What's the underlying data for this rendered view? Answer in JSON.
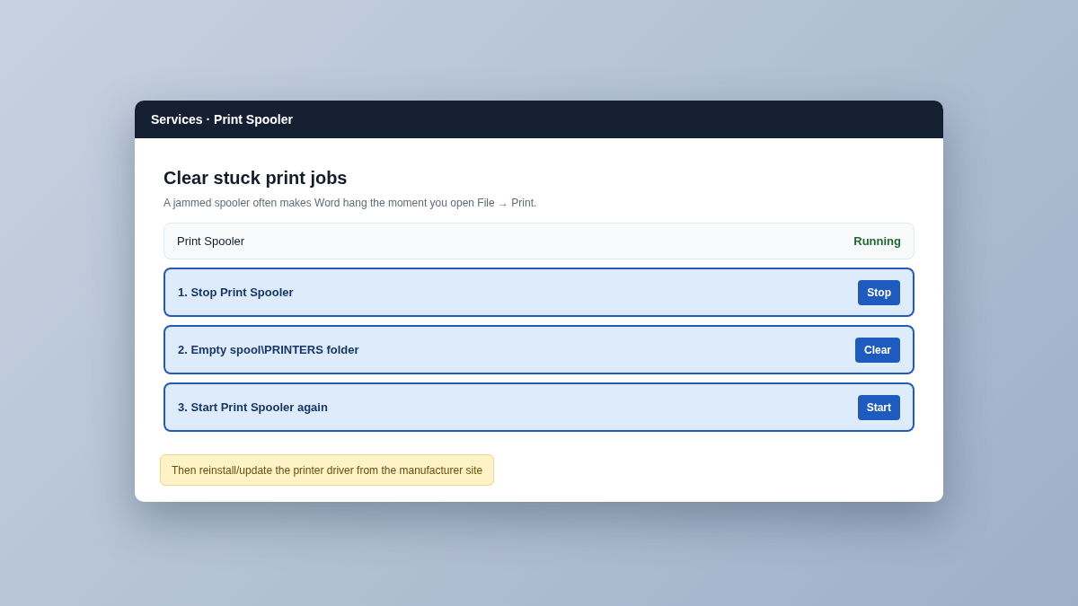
{
  "window": {
    "title": "Services · Print Spooler"
  },
  "heading": "Clear stuck print jobs",
  "subtitle": "A jammed spooler often makes Word hang the moment you open File → Print.",
  "service": {
    "name": "Print Spooler",
    "status": "Running"
  },
  "steps": [
    {
      "label": "1. Stop Print Spooler",
      "button": "Stop"
    },
    {
      "label": "2. Empty spool\\PRINTERS folder",
      "button": "Clear"
    },
    {
      "label": "3. Start Print Spooler again",
      "button": "Start"
    }
  ],
  "note": "Then reinstall/update the printer driver from the manufacturer site"
}
